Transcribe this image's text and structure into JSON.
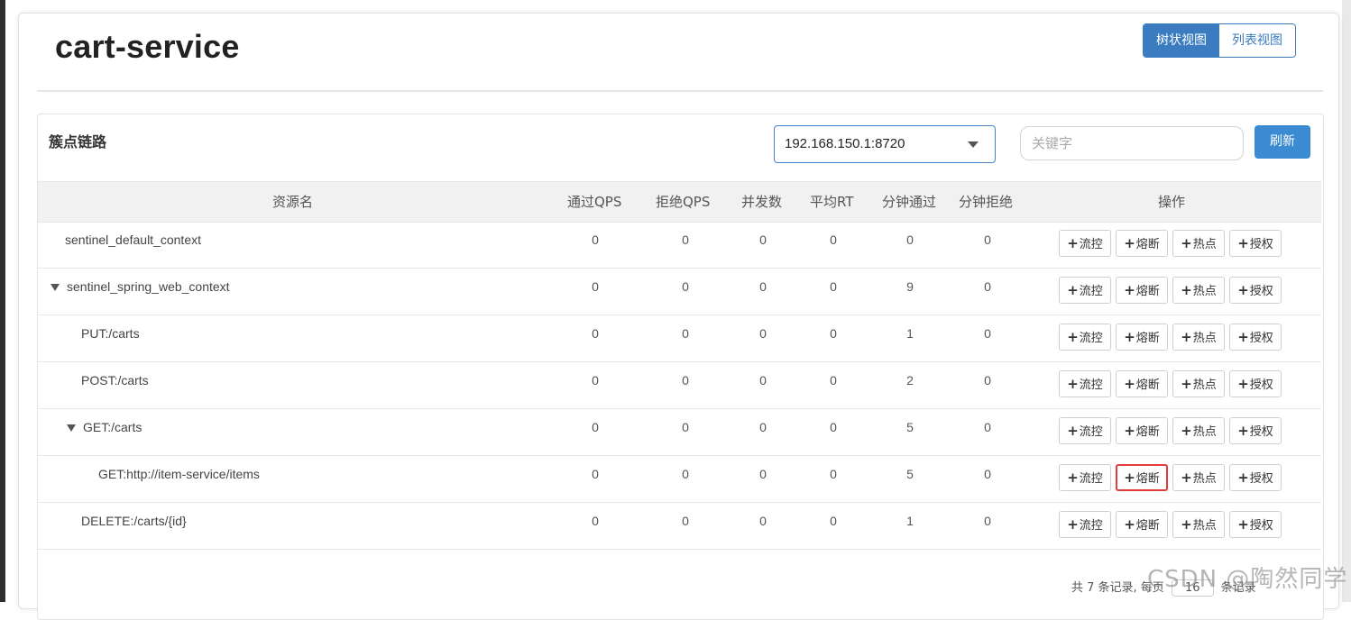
{
  "app": {
    "title": "cart-service"
  },
  "view_toggle": {
    "tree": "树状视图",
    "list": "列表视图"
  },
  "panel": {
    "title": "簇点链路",
    "machine": "192.168.150.1:8720",
    "keyword_placeholder": "关键字",
    "refresh": "刷新"
  },
  "table": {
    "headers": [
      "资源名",
      "通过QPS",
      "拒绝QPS",
      "并发数",
      "平均RT",
      "分钟通过",
      "分钟拒绝",
      "操作"
    ],
    "rows": [
      {
        "name": "sentinel_default_context",
        "indent": 0,
        "expanded": false,
        "values": [
          "0",
          "0",
          "0",
          "0",
          "0",
          "0"
        ]
      },
      {
        "name": "sentinel_spring_web_context",
        "indent": 0,
        "expanded": true,
        "values": [
          "0",
          "0",
          "0",
          "0",
          "9",
          "0"
        ]
      },
      {
        "name": "PUT:/carts",
        "indent": 1,
        "expanded": false,
        "values": [
          "0",
          "0",
          "0",
          "0",
          "1",
          "0"
        ]
      },
      {
        "name": "POST:/carts",
        "indent": 1,
        "expanded": false,
        "values": [
          "0",
          "0",
          "0",
          "0",
          "2",
          "0"
        ]
      },
      {
        "name": "GET:/carts",
        "indent": 1,
        "expanded": true,
        "values": [
          "0",
          "0",
          "0",
          "0",
          "5",
          "0"
        ]
      },
      {
        "name": "GET:http://item-service/items",
        "indent": 2,
        "expanded": false,
        "values": [
          "0",
          "0",
          "0",
          "0",
          "5",
          "0"
        ]
      },
      {
        "name": "DELETE:/carts/{id}",
        "indent": 1,
        "expanded": false,
        "values": [
          "0",
          "0",
          "0",
          "0",
          "1",
          "0"
        ]
      }
    ],
    "actions": [
      "流控",
      "熔断",
      "热点",
      "授权"
    ],
    "highlight": {
      "row": 5,
      "action": 1,
      "color": "#e23b3b"
    }
  },
  "footer": {
    "prefix": "共 7 条记录, 每页",
    "page_size": "16",
    "suffix": "条记录"
  },
  "watermark": "CSDN @陶然同学"
}
